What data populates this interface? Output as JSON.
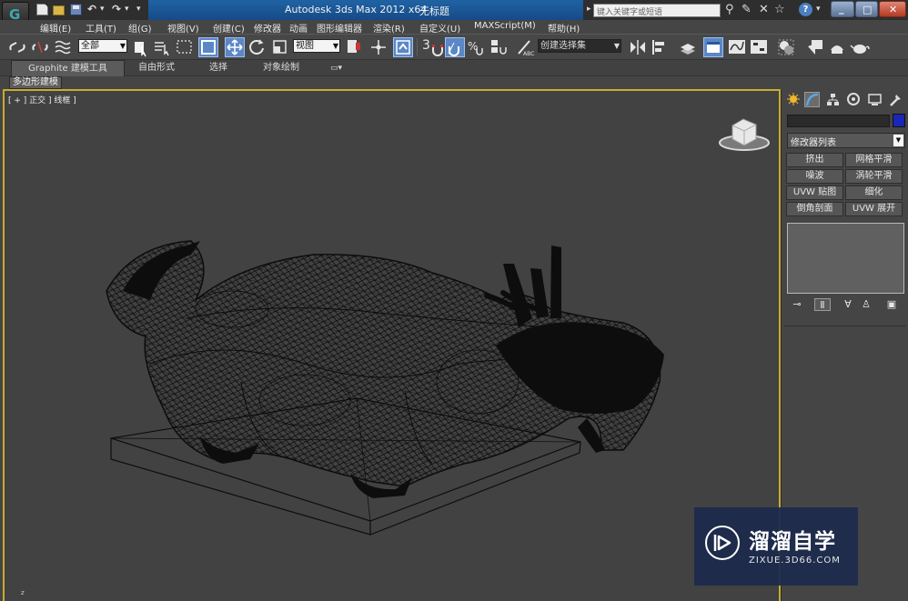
{
  "titlebar": {
    "app_logo": "3ds-max-logo",
    "app_title": "Autodesk 3ds Max  2012 x64",
    "document_title": "无标题",
    "search_placeholder": "键入关键字或短语",
    "window_buttons": [
      "minimize",
      "maximize",
      "close"
    ]
  },
  "menus": [
    "编辑(E)",
    "工具(T)",
    "组(G)",
    "视图(V)",
    "创建(C)",
    "修改器",
    "动画",
    "图形编辑器",
    "渲染(R)",
    "自定义(U)",
    "MAXScript(M)",
    "帮助(H)"
  ],
  "toolbar": {
    "selection_filter": "全部",
    "ref_coord_system": "视图",
    "snap_label": "3",
    "named_selection_set": "创建选择集"
  },
  "ribbon": {
    "tabs": [
      "Graphite 建模工具",
      "自由形式",
      "选择",
      "对象绘制"
    ],
    "active_tab": "Graphite 建模工具",
    "subtab": "多边形建模"
  },
  "viewport": {
    "label": "[ + ] 正交 ] 线框 ]",
    "shading": "wireframe",
    "axis_label": "z",
    "border_color": "#c8ac2e"
  },
  "command_panel": {
    "object_color": "#1a26b8",
    "modifier_list": "修改器列表",
    "modifier_buttons": [
      [
        "挤出",
        "网格平滑"
      ],
      [
        "噪波",
        "涡轮平滑"
      ],
      [
        "UVW 贴图",
        "细化"
      ],
      [
        "倒角剖面",
        "UVW 展开"
      ]
    ]
  },
  "watermark": {
    "name": "溜溜自学",
    "url": "ZIXUE.3D66.COM"
  }
}
